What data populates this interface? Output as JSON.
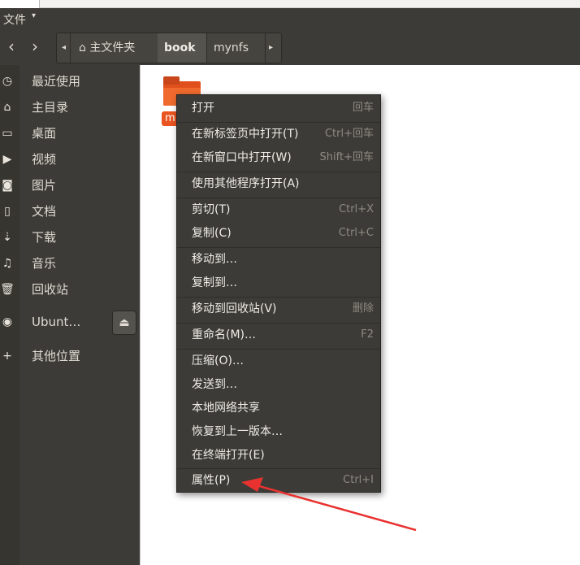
{
  "menubar": {
    "file_label": "文件",
    "caret": "▾"
  },
  "toolbar": {
    "back_icon": "‹",
    "forward_icon": "›",
    "crumb_left_arrow": "◂",
    "crumb_right_arrow": "▸",
    "home_icon": "⌂",
    "breadcrumbs": [
      "主文件夹",
      "book",
      "mynfs"
    ]
  },
  "sidebar": {
    "items": [
      {
        "icon": "◷",
        "label": "最近使用"
      },
      {
        "icon": "⌂",
        "label": "主目录"
      },
      {
        "icon": "▭",
        "label": "桌面"
      },
      {
        "icon": "▶",
        "label": "视频"
      },
      {
        "icon": "◙",
        "label": "图片"
      },
      {
        "icon": "▯",
        "label": "文档"
      },
      {
        "icon": "⇣",
        "label": "下载"
      },
      {
        "icon": "♫",
        "label": "音乐"
      },
      {
        "icon": "🗑",
        "label": "回收站"
      },
      {
        "icon": "◉",
        "label": "Ubunt…"
      },
      {
        "icon": "+",
        "label": "其他位置"
      }
    ],
    "eject_icon": "⏏"
  },
  "content": {
    "folder_label": "m"
  },
  "context_menu": {
    "items": [
      {
        "label": "打开",
        "accel": "回车"
      },
      {
        "label": "在新标签页中打开(T)",
        "accel": "Ctrl+回车"
      },
      {
        "label": "在新窗口中打开(W)",
        "accel": "Shift+回车"
      },
      {
        "label": "使用其他程序打开(A)",
        "accel": ""
      },
      {
        "label": "剪切(T)",
        "accel": "Ctrl+X"
      },
      {
        "label": "复制(C)",
        "accel": "Ctrl+C"
      },
      {
        "label": "移动到…",
        "accel": ""
      },
      {
        "label": "复制到…",
        "accel": ""
      },
      {
        "label": "移动到回收站(V)",
        "accel": "删除"
      },
      {
        "label": "重命名(M)…",
        "accel": "F2"
      },
      {
        "label": "压缩(O)…",
        "accel": ""
      },
      {
        "label": "发送到…",
        "accel": ""
      },
      {
        "label": "本地网络共享",
        "accel": ""
      },
      {
        "label": "恢复到上一版本…",
        "accel": ""
      },
      {
        "label": "在终端打开(E)",
        "accel": ""
      },
      {
        "label": "属性(P)",
        "accel": "Ctrl+I"
      }
    ]
  },
  "colors": {
    "accent": "#e95420",
    "panel": "#3c3b37",
    "arrow": "#e8322f"
  }
}
